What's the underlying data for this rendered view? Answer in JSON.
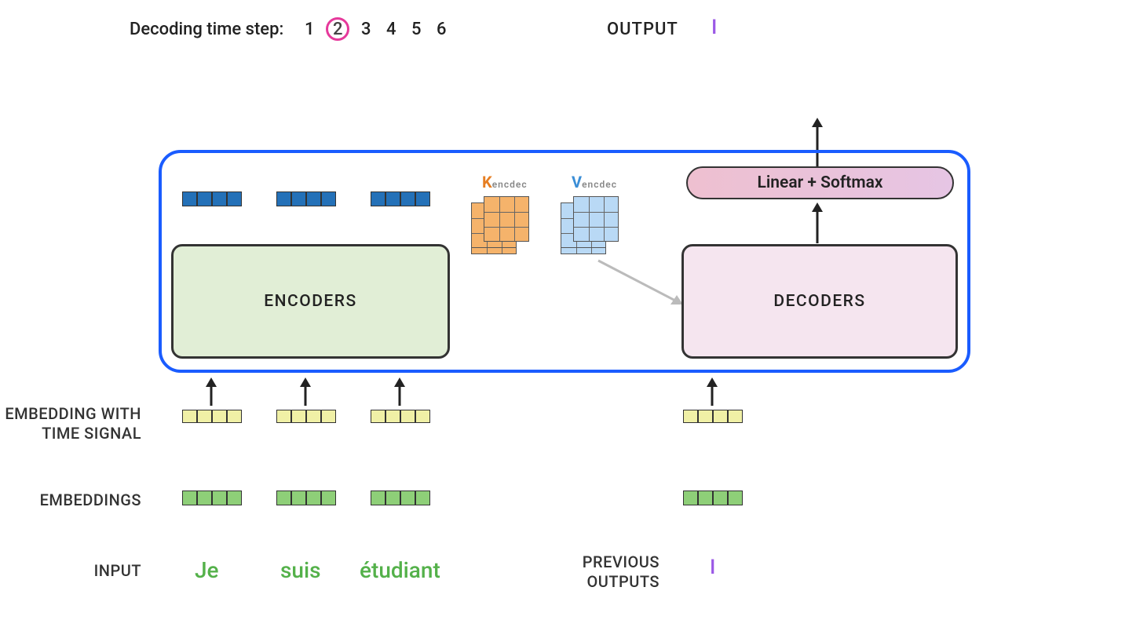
{
  "timestep": {
    "label": "Decoding time step:",
    "steps": [
      "1",
      "2",
      "3",
      "4",
      "5",
      "6"
    ],
    "current_index": 1
  },
  "output": {
    "label": "OUTPUT",
    "token": "I"
  },
  "kv": {
    "k_letter": "K",
    "k_sub": "encdec",
    "v_letter": "V",
    "v_sub": "encdec"
  },
  "blocks": {
    "encoders": "ENCODERS",
    "decoders": "DECODERS",
    "softmax": "Linear + Softmax"
  },
  "side_labels": {
    "embedding_time": "EMBEDDING WITH TIME SIGNAL",
    "embeddings": "EMBEDDINGS",
    "input": "INPUT",
    "previous_outputs": "PREVIOUS OUTPUTS"
  },
  "input_words": [
    "Je",
    "suis",
    "étudiant"
  ],
  "previous_output_token": "I",
  "colors": {
    "highlight_pink": "#e6399b",
    "container_blue": "#1a5cff",
    "encoder_fill": "#e1eed6",
    "decoder_fill": "#f5e5ef",
    "k_orange": "#e67e22",
    "v_blue": "#3b8ed6",
    "word_green": "#54b14a",
    "token_purple": "#9b59e6"
  }
}
